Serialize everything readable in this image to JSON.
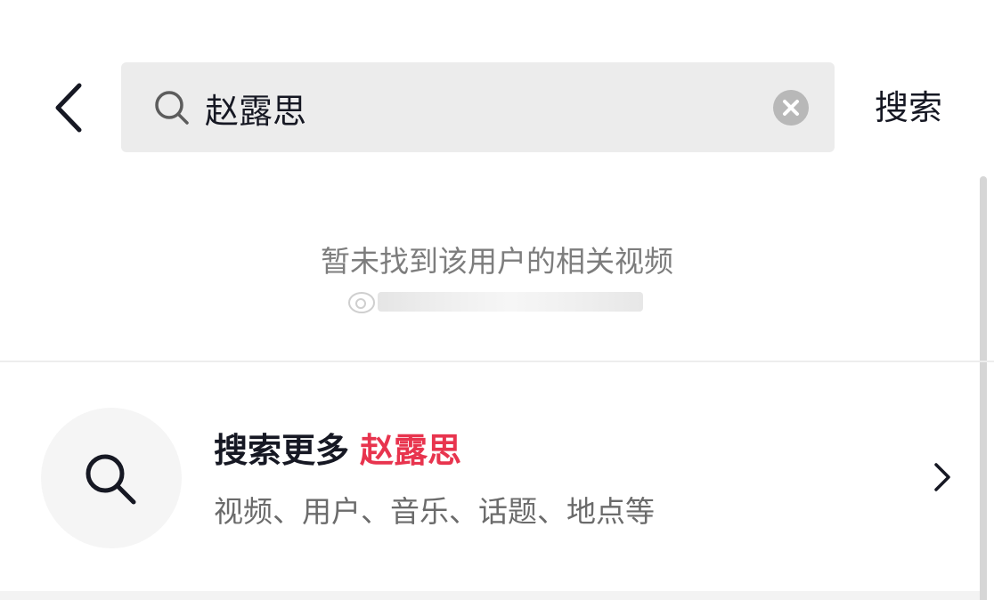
{
  "header": {
    "search_query": "赵露思",
    "submit_label": "搜索"
  },
  "results": {
    "empty_message": "暂未找到该用户的相关视频"
  },
  "search_more": {
    "title": "搜索更多",
    "keyword": "赵露思",
    "subtitle": "视频、用户、音乐、话题、地点等"
  },
  "icons": {
    "back": "chevron-left-icon",
    "search": "search-icon",
    "clear": "clear-icon",
    "chevron": "chevron-right-icon"
  },
  "colors": {
    "keyword_highlight": "#e8344e",
    "search_box_bg": "#ececec",
    "text_primary": "#161823",
    "text_secondary": "#7d7d7d"
  }
}
